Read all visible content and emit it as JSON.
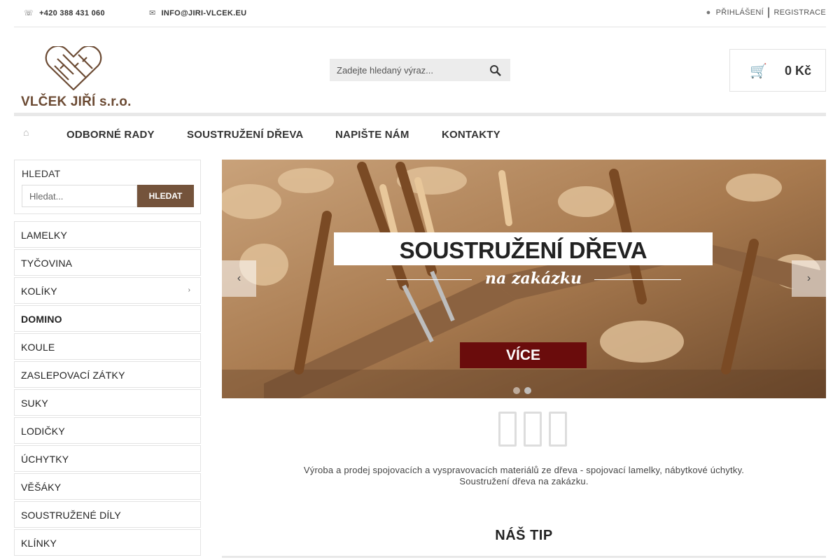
{
  "topbar": {
    "phone": "+420 388 431 060",
    "email": "INFO@JIRI-VLCEK.EU",
    "login": "PŘIHLÁŠENÍ",
    "separator": "|",
    "register": "REGISTRACE",
    "phone_icon": "phone-icon",
    "email_icon": "envelope-icon",
    "login_icon": "user-icon"
  },
  "logo": {
    "text": "VLČEK JIŘÍ s.r.o."
  },
  "search": {
    "placeholder": "Zadejte hledaný výraz...",
    "icon": "search-icon"
  },
  "cart": {
    "icon": "cart-icon",
    "price": "0 Kč"
  },
  "nav": {
    "home_icon": "home-icon",
    "items": [
      {
        "label": "ODBORNÉ RADY"
      },
      {
        "label": "SOUSTRUŽENÍ DŘEVA"
      },
      {
        "label": "NAPIŠTE NÁM"
      },
      {
        "label": "KONTAKTY"
      }
    ]
  },
  "sidebar": {
    "search_title": "HLEDAT",
    "search_placeholder": "Hledat...",
    "search_button": "HLEDAT",
    "categories": [
      {
        "label": "LAMELKY"
      },
      {
        "label": "TYČOVINA"
      },
      {
        "label": "KOLÍKY",
        "has_submenu": true
      },
      {
        "label": "DOMINO",
        "active": true
      },
      {
        "label": "KOULE"
      },
      {
        "label": "ZASLEPOVACÍ ZÁTKY"
      },
      {
        "label": "SUKY"
      },
      {
        "label": "LODIČKY"
      },
      {
        "label": "ÚCHYTKY"
      },
      {
        "label": "VĚŠÁKY"
      },
      {
        "label": "SOUSTRUŽENÉ DÍLY"
      },
      {
        "label": "KLÍNKY"
      }
    ]
  },
  "banner": {
    "title": "SOUSTRUŽENÍ DŘEVA",
    "subtitle": "na zakázku",
    "button": "VÍCE",
    "prev_icon": "chevron-left-icon",
    "next_icon": "chevron-right-icon",
    "slide_count": 2,
    "active_slide": 2
  },
  "main": {
    "description_line1": "Výroba a prodej spojovacích a vyspravovacích materiálů ze dřeva - spojovací lamelky, nábytkové úchytky.",
    "description_line2": "Soustružení dřeva na zakázku.",
    "tip_title": "NÁŠ TIP"
  },
  "colors": {
    "brand_brown": "#74533b",
    "banner_button": "#6a0c0c"
  }
}
